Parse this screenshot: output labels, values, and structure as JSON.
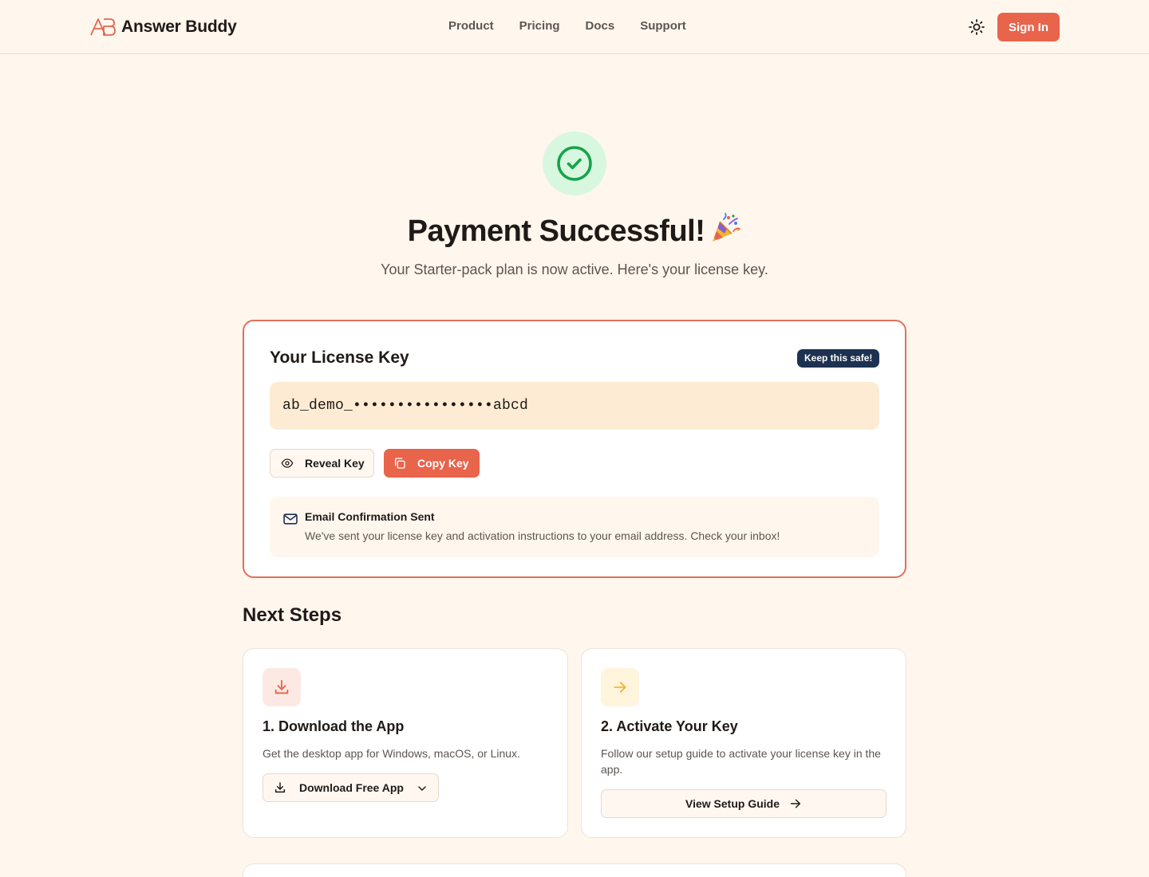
{
  "header": {
    "brand": "Answer Buddy",
    "nav": [
      "Product",
      "Pricing",
      "Docs",
      "Support"
    ],
    "sign_in_label": "Sign In",
    "theme_icon": "sun-icon"
  },
  "hero": {
    "title": "Payment Successful!",
    "subtitle": "Your Starter-pack plan is now active. Here's your license key."
  },
  "license": {
    "title": "Your License Key",
    "badge": "Keep this safe!",
    "key_masked": "ab_demo_••••••••••••••••abcd",
    "reveal_label": "Reveal Key",
    "copy_label": "Copy Key",
    "email_title": "Email Confirmation Sent",
    "email_text": "We've sent your license key and activation instructions to your email address. Check your inbox!"
  },
  "next_steps": {
    "title": "Next Steps",
    "steps": [
      {
        "title": "1. Download the App",
        "description": "Get the desktop app for Windows, macOS, or Linux.",
        "button_label": "Download Free App",
        "icon": "download-icon"
      },
      {
        "title": "2. Activate Your Key",
        "description": "Follow our setup guide to activate your license key in the app.",
        "button_label": "View Setup Guide",
        "icon": "arrow-right-icon"
      }
    ]
  },
  "colors": {
    "background": "#fff6ee",
    "accent": "#e8644b",
    "success": "#16a34a",
    "badge": "#1d3150"
  }
}
